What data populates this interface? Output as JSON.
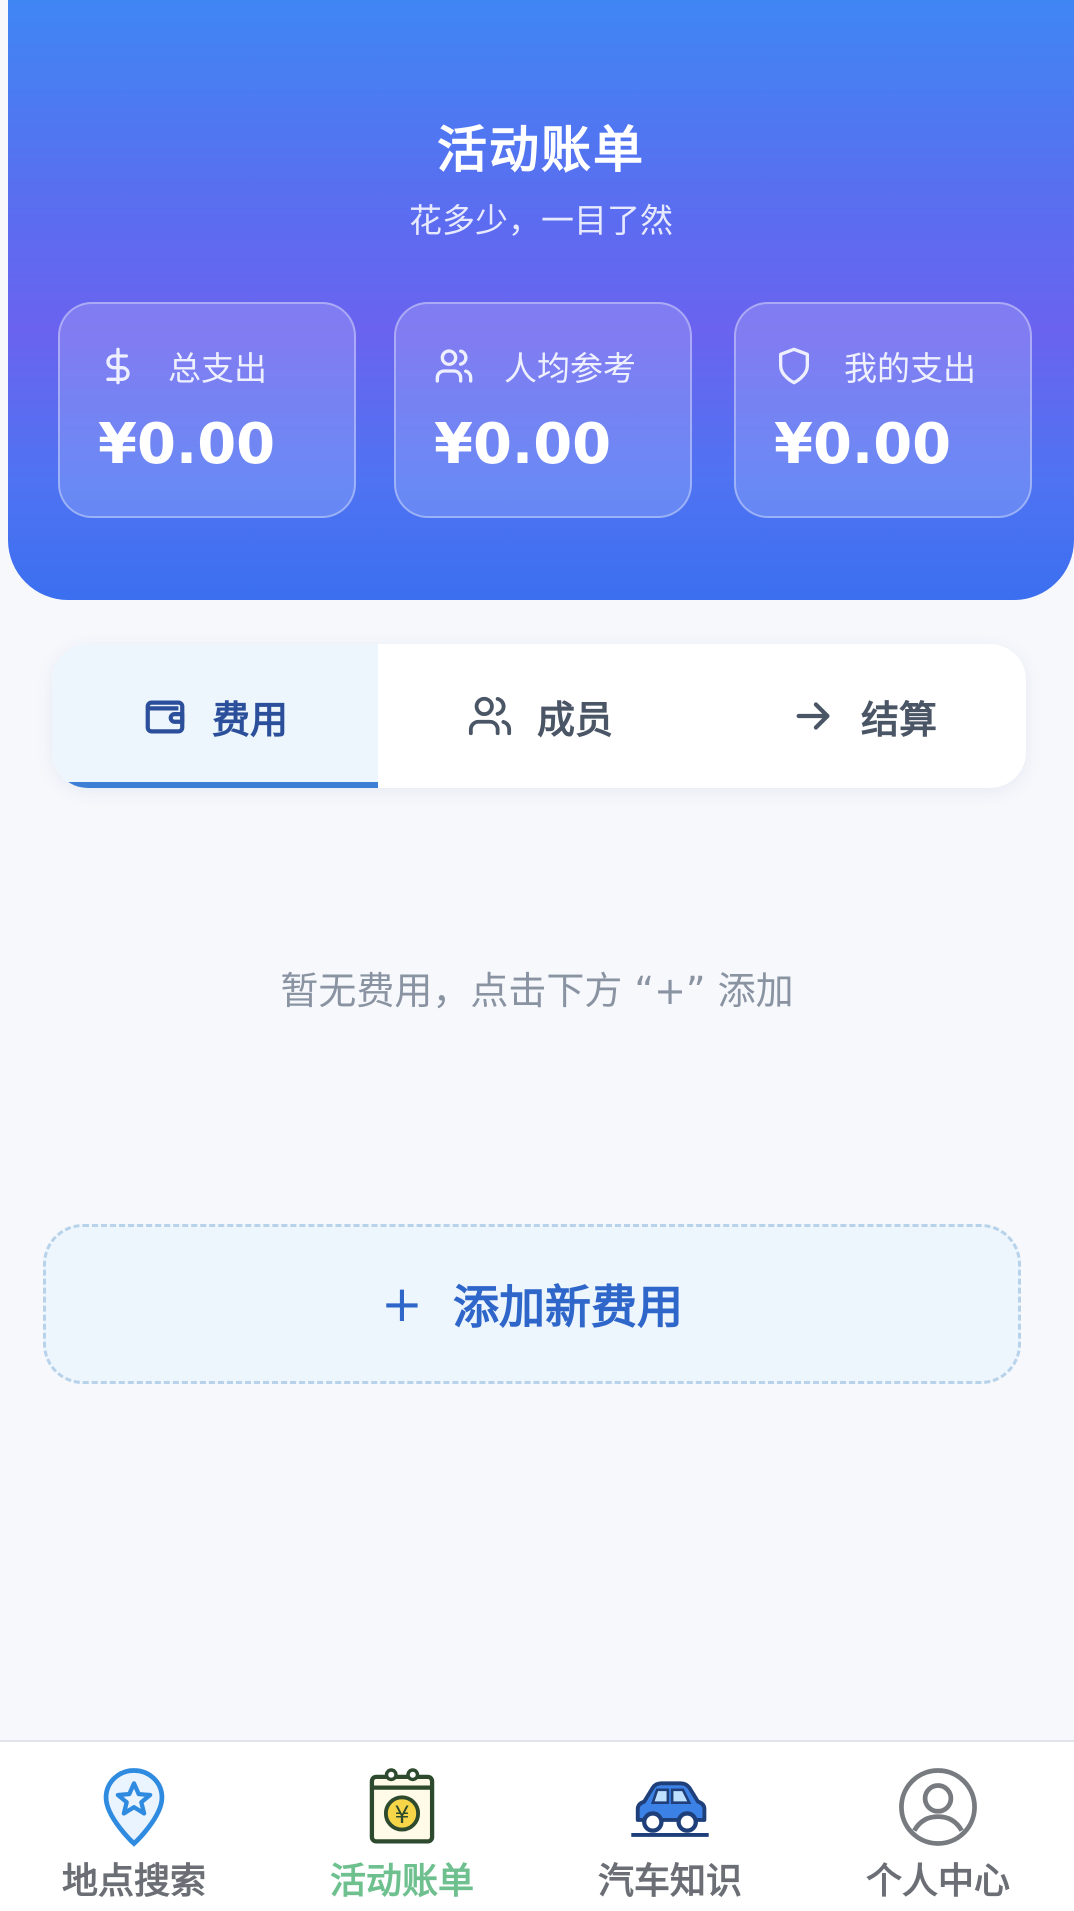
{
  "header": {
    "title": "活动账单",
    "subtitle": "花多少，一目了然"
  },
  "stats": [
    {
      "icon": "dollar-icon",
      "label": "总支出",
      "value": "¥0.00"
    },
    {
      "icon": "users-icon",
      "label": "人均参考",
      "value": "¥0.00"
    },
    {
      "icon": "shield-icon",
      "label": "我的支出",
      "value": "¥0.00"
    }
  ],
  "tabs": [
    {
      "icon": "wallet-icon",
      "label": "费用",
      "active": true
    },
    {
      "icon": "users-icon",
      "label": "成员",
      "active": false
    },
    {
      "icon": "arrow-right-icon",
      "label": "结算",
      "active": false
    }
  ],
  "empty_text": "暂无费用，点击下方 “+” 添加",
  "add_button": {
    "icon": "plus-icon",
    "label": "添加新费用"
  },
  "bottom_nav": [
    {
      "icon": "map-pin-star-icon",
      "label": "地点搜索",
      "active": false
    },
    {
      "icon": "calendar-yen-icon",
      "label": "活动账单",
      "active": true
    },
    {
      "icon": "car-icon",
      "label": "汽车知识",
      "active": false
    },
    {
      "icon": "user-circle-icon",
      "label": "个人中心",
      "active": false
    }
  ],
  "colors": {
    "header_top": "#3f86f3",
    "header_mid": "#6a63ef",
    "accent": "#2f66c9",
    "nav_active": "#6fc08f"
  }
}
